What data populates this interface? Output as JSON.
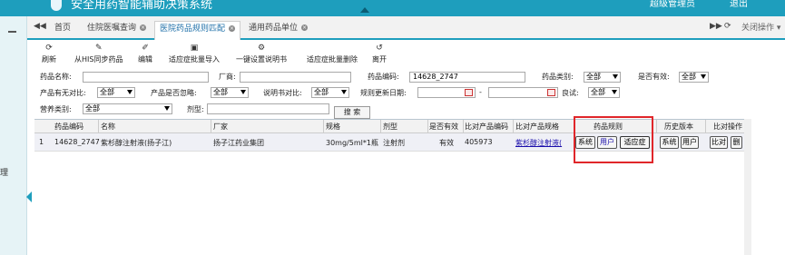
{
  "app": {
    "title": "安全用药智能辅助决策系统",
    "user": "超级管理员",
    "logout": "退出"
  },
  "tabs": [
    {
      "label": "首页"
    },
    {
      "label": "住院医嘱查询"
    },
    {
      "label": "医院药品规则匹配"
    },
    {
      "label": "通用药品单位"
    }
  ],
  "close_ops": "关闭操作",
  "toolbar": {
    "refresh": "刷新",
    "sync": "从HIS同步药品",
    "edit": "编辑",
    "batch_import": "适应症批量导入",
    "set_manual": "一键设置说明书",
    "batch_delete": "适应症批量删除",
    "leave": "离开"
  },
  "filters": {
    "drug_name_label": "药品名称:",
    "drug_name_value": "",
    "manufacturer_label": "厂商:",
    "manufacturer_value": "",
    "drug_code_label": "药品编码:",
    "drug_code_value": "14628_2747",
    "drug_category_label": "药品类别:",
    "drug_category_value": "全部",
    "valid_label": "是否有效:",
    "valid_value": "全部",
    "has_product_label": "产品有无对比:",
    "has_product_value": "全部",
    "product_ignored_label": "产品是否忽略:",
    "product_ignored_value": "全部",
    "manual_compare_label": "说明书对比:",
    "manual_compare_value": "全部",
    "rule_update_label": "规则更新日期:",
    "date_sep": "-",
    "good_label": "良试:",
    "good_value": "全部",
    "nutrition_label": "营养类别:",
    "nutrition_value": "全部",
    "dosage_label": "剂型:",
    "dosage_value": "",
    "search": "搜 索"
  },
  "grid": {
    "headers": [
      "药品编码",
      "名称",
      "厂家",
      "规格",
      "剂型",
      "是否有效",
      "比对产品编码",
      "比对产品规格",
      "药品规则",
      "历史版本",
      "比对操作"
    ],
    "rows": [
      {
        "index": "1",
        "code": "14628_2747",
        "name": "紫杉醇注射液(扬子江)",
        "manufacturer": "扬子江药业集团",
        "spec": "30mg/5ml*1瓶",
        "dosage": "注射剂",
        "valid": "有效",
        "product_code": "405973",
        "product_spec": "紫杉醇注射液(",
        "rule_buttons": [
          "系统",
          "用户",
          "适应症"
        ],
        "history_buttons": [
          "系统",
          "用户"
        ],
        "compare_buttons": [
          "比对",
          "删"
        ]
      }
    ]
  },
  "left_char": "理"
}
